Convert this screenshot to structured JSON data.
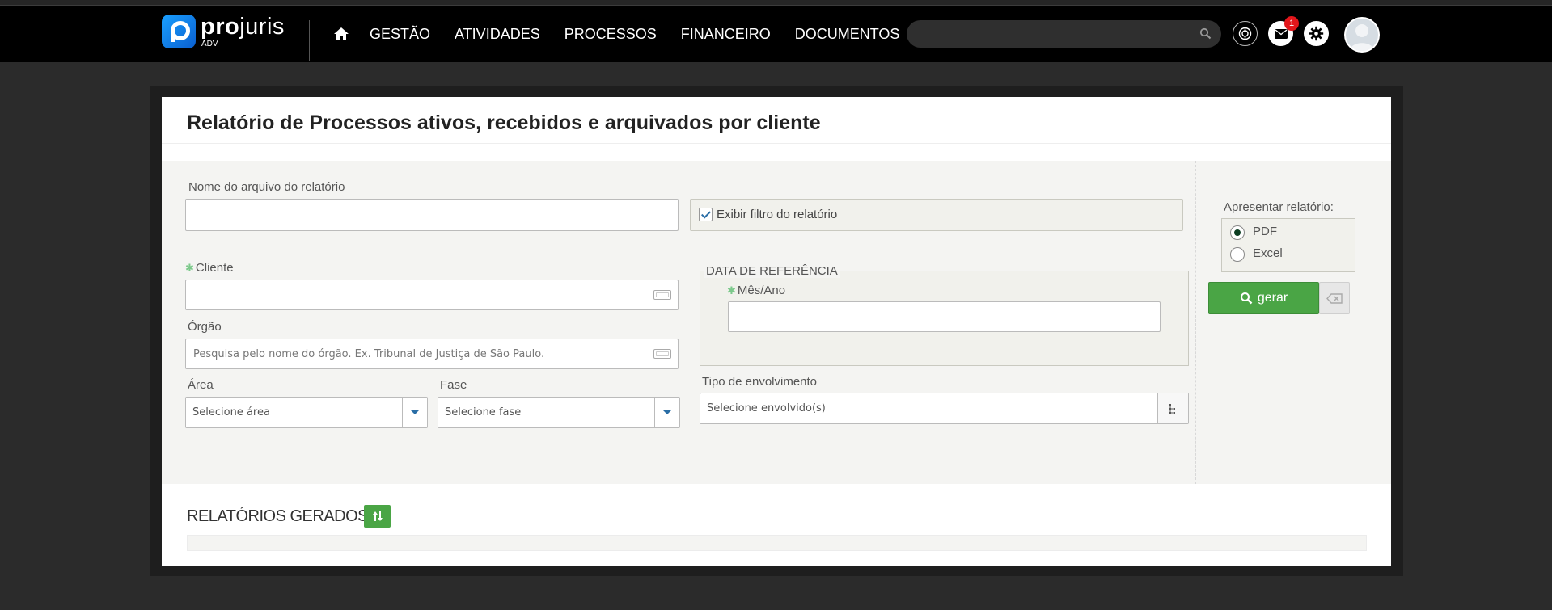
{
  "header": {
    "logo": {
      "word_bold": "pro",
      "word_light": "juris",
      "sub": "ADV"
    },
    "nav": [
      "GESTÃO",
      "ATIVIDADES",
      "PROCESSOS",
      "FINANCEIRO",
      "DOCUMENTOS"
    ],
    "search_placeholder": "",
    "notification_count": "1"
  },
  "page": {
    "title": "Relatório de Processos ativos, recebidos e arquivados por cliente"
  },
  "form": {
    "nome_arquivo": {
      "label": "Nome do arquivo do relatório",
      "value": ""
    },
    "exibir_filtro": {
      "label": "Exibir filtro do relatório",
      "checked": true
    },
    "cliente": {
      "label": "Cliente",
      "value": ""
    },
    "orgao": {
      "label": "Órgão",
      "placeholder": "Pesquisa pelo nome do órgão. Ex. Tribunal de Justiça de São Paulo."
    },
    "area": {
      "label": "Área",
      "value": "Selecione área"
    },
    "fase": {
      "label": "Fase",
      "value": "Selecione fase"
    },
    "data_referencia": {
      "legend": "DATA DE REFERÊNCIA",
      "mes_ano_label": "Mês/Ano",
      "mes_ano_value": ""
    },
    "tipo_envolvimento": {
      "label": "Tipo de envolvimento",
      "value": "Selecione envolvido(s)"
    },
    "apresentar": {
      "label": "Apresentar relatório:",
      "options": [
        "PDF",
        "Excel"
      ],
      "selected": "PDF"
    },
    "gerar_label": "gerar"
  },
  "gerados": {
    "title": "RELATÓRIOS GERADOS"
  },
  "colors": {
    "accent_green": "#4aa545",
    "topbar": "#000000",
    "logo_blue": "#1aa0ff",
    "badge_red": "#e3161b"
  }
}
